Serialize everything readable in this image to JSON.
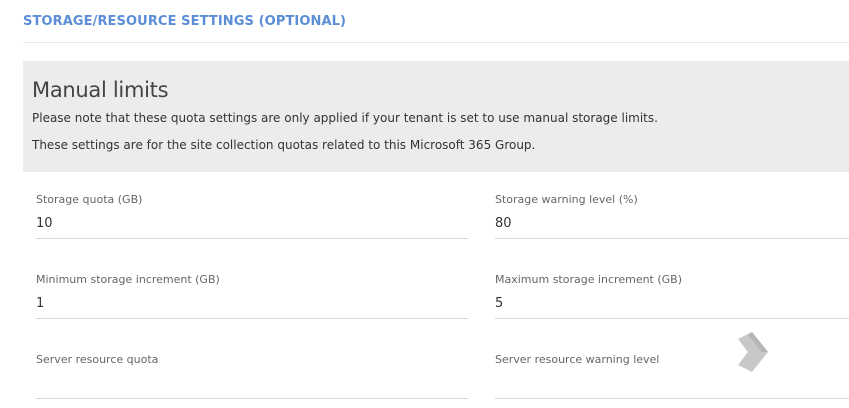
{
  "section": {
    "title": "STORAGE/RESOURCE SETTINGS (OPTIONAL)"
  },
  "manual_limits": {
    "heading": "Manual limits",
    "note_line_1": "Please note that these quota settings are only applied if your tenant is set to use manual storage limits.",
    "note_line_2": "These settings are for the site collection quotas related to this Microsoft 365 Group."
  },
  "fields": {
    "storage_quota": {
      "label": "Storage quota (GB)",
      "value": "10"
    },
    "storage_warning_level": {
      "label": "Storage warning level (%)",
      "value": "80"
    },
    "min_storage_increment": {
      "label": "Minimum storage increment (GB)",
      "value": "1"
    },
    "max_storage_increment": {
      "label": "Maximum storage increment (GB)",
      "value": "5"
    },
    "server_resource_quota": {
      "label": "Server resource quota",
      "value": ""
    },
    "server_resource_warning_level": {
      "label": "Server resource warning level",
      "value": ""
    }
  },
  "icons": {
    "floating": "diamond-chevron-icon"
  },
  "colors": {
    "accent": "#5b8ed6",
    "info_background": "#ececec",
    "icon_gray": "#c8c8c8"
  }
}
